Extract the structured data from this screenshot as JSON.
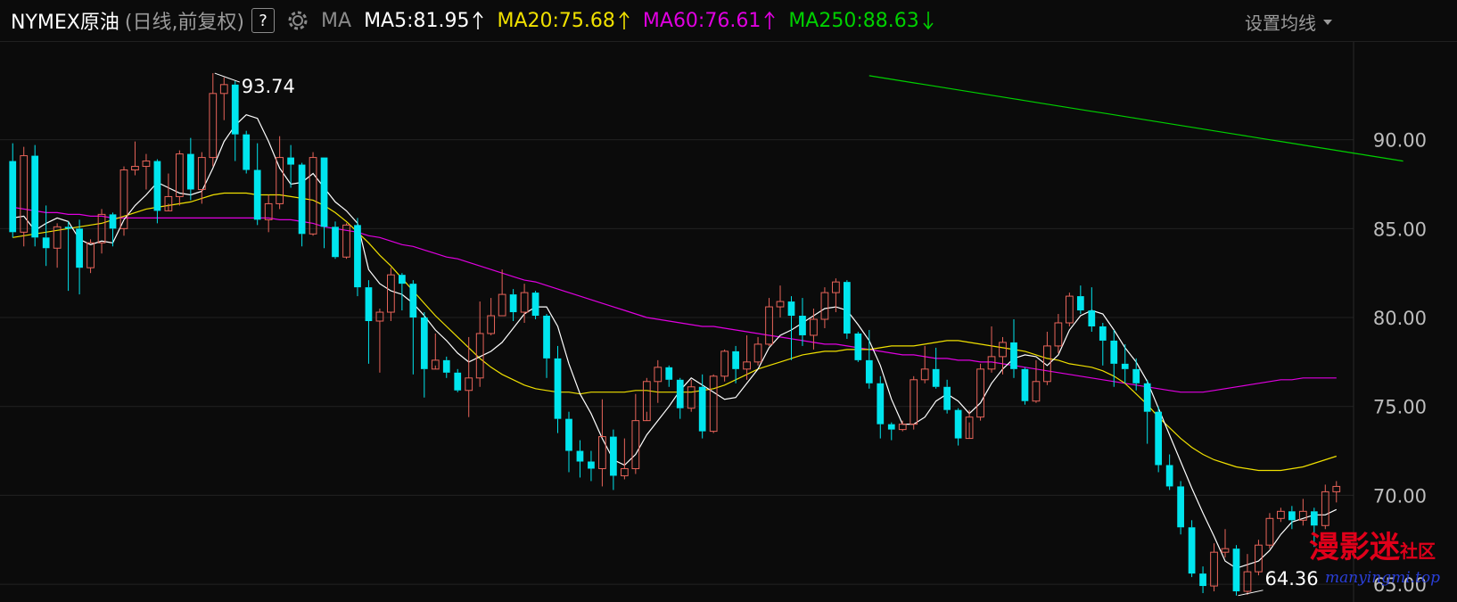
{
  "header": {
    "title": "NYMEX原油",
    "subtitle": "(日线,前复权)",
    "help": "?",
    "ma_label": "MA",
    "ma": [
      {
        "text": "MA5:81.95",
        "color": "#ffffff",
        "dir": "up"
      },
      {
        "text": "MA20:75.68",
        "color": "#f0e000",
        "dir": "up"
      },
      {
        "text": "MA60:76.61",
        "color": "#e000e0",
        "dir": "up"
      },
      {
        "text": "MA250:88.63",
        "color": "#00d000",
        "dir": "down"
      }
    ],
    "settings": "设置均线"
  },
  "watermark": {
    "main": "漫影迷",
    "small": "社区",
    "url": "manyingmi.top"
  },
  "colors": {
    "up": "#e8645a",
    "down": "#00e5ee",
    "ma5": "#ffffff",
    "ma20": "#f0e000",
    "ma60": "#e000e0",
    "ma250": "#00d000"
  },
  "chart_data": {
    "type": "candlestick",
    "y_axis": {
      "ticks": [
        "90.00",
        "85.00",
        "80.00",
        "75.00",
        "70.00",
        "65.00"
      ],
      "range": [
        64,
        95.5
      ]
    },
    "annotations": [
      {
        "text": "93.74",
        "candle": 18,
        "value": 93.74
      },
      {
        "text": "64.36",
        "candle": 110,
        "value": 64.36
      }
    ],
    "candles": [
      [
        88.8,
        84.8,
        89.8,
        84.5
      ],
      [
        84.8,
        89.1,
        89.6,
        84.0
      ],
      [
        89.1,
        84.5,
        89.7,
        84.0
      ],
      [
        84.5,
        83.9,
        86.3,
        82.9
      ],
      [
        83.9,
        85.1,
        85.3,
        82.8
      ],
      [
        85.1,
        85.0,
        85.4,
        81.5
      ],
      [
        85.0,
        82.8,
        85.5,
        81.3
      ],
      [
        82.8,
        84.2,
        84.4,
        82.5
      ],
      [
        84.2,
        85.8,
        86.1,
        83.6
      ],
      [
        85.8,
        85.0,
        85.9,
        84.0
      ],
      [
        85.0,
        88.3,
        88.5,
        84.6
      ],
      [
        88.3,
        88.5,
        89.9,
        88.0
      ],
      [
        88.5,
        88.8,
        89.2,
        87.2
      ],
      [
        88.8,
        86.0,
        88.9,
        85.3
      ],
      [
        86.0,
        86.8,
        88.1,
        86.4
      ],
      [
        86.8,
        89.2,
        89.4,
        86.3
      ],
      [
        89.2,
        87.2,
        90.1,
        86.6
      ],
      [
        87.2,
        89.0,
        89.3,
        86.4
      ],
      [
        89.0,
        92.6,
        93.74,
        88.5
      ],
      [
        92.6,
        93.1,
        93.5,
        91.1
      ],
      [
        93.1,
        90.3,
        93.3,
        88.8
      ],
      [
        90.3,
        88.3,
        90.5,
        88.1
      ],
      [
        88.3,
        85.5,
        89.8,
        85.2
      ],
      [
        85.5,
        86.4,
        86.9,
        84.8
      ],
      [
        86.4,
        89.0,
        90.2,
        86.1
      ],
      [
        89.0,
        88.6,
        89.7,
        87.3
      ],
      [
        88.6,
        84.7,
        88.7,
        84.0
      ],
      [
        84.7,
        89.0,
        89.3,
        84.6
      ],
      [
        89.0,
        85.1,
        89.0,
        83.9
      ],
      [
        85.1,
        83.4,
        85.4,
        83.3
      ],
      [
        83.4,
        85.2,
        85.3,
        83.3
      ],
      [
        85.2,
        81.7,
        85.6,
        81.2
      ],
      [
        81.7,
        79.8,
        82.1,
        77.4
      ],
      [
        79.8,
        80.3,
        80.5,
        76.9
      ],
      [
        80.3,
        82.4,
        82.8,
        79.8
      ],
      [
        82.4,
        81.9,
        82.5,
        80.4
      ],
      [
        81.9,
        80.0,
        82.1,
        76.8
      ],
      [
        80.0,
        77.1,
        80.3,
        75.5
      ],
      [
        77.1,
        77.6,
        79.1,
        77.3
      ],
      [
        77.6,
        76.9,
        77.8,
        76.6
      ],
      [
        76.9,
        75.9,
        77.1,
        75.8
      ],
      [
        75.9,
        76.6,
        78.9,
        74.4
      ],
      [
        76.6,
        79.1,
        80.9,
        76.1
      ],
      [
        79.1,
        80.1,
        81.1,
        79.0
      ],
      [
        80.1,
        81.3,
        82.7,
        80.1
      ],
      [
        81.3,
        80.3,
        81.6,
        79.8
      ],
      [
        80.3,
        81.4,
        81.9,
        79.7
      ],
      [
        81.4,
        80.1,
        81.5,
        79.9
      ],
      [
        80.1,
        77.7,
        80.2,
        76.6
      ],
      [
        77.7,
        74.3,
        78.4,
        73.5
      ],
      [
        74.3,
        72.5,
        74.7,
        71.3
      ],
      [
        72.5,
        71.9,
        73.1,
        71.0
      ],
      [
        71.9,
        71.5,
        72.5,
        70.8
      ],
      [
        71.5,
        73.3,
        75.4,
        70.5
      ],
      [
        73.3,
        71.1,
        73.7,
        70.3
      ],
      [
        71.1,
        71.5,
        73.2,
        70.9
      ],
      [
        71.5,
        74.2,
        75.7,
        71.2
      ],
      [
        74.2,
        76.4,
        76.6,
        74.7
      ],
      [
        76.4,
        77.2,
        77.6,
        75.2
      ],
      [
        77.2,
        76.5,
        77.3,
        76.1
      ],
      [
        76.5,
        74.9,
        76.6,
        74.3
      ],
      [
        74.9,
        76.1,
        76.5,
        74.7
      ],
      [
        76.1,
        73.6,
        76.8,
        73.2
      ],
      [
        73.6,
        76.7,
        76.8,
        73.5
      ],
      [
        76.7,
        78.1,
        78.2,
        76.4
      ],
      [
        78.1,
        77.1,
        78.4,
        76.3
      ],
      [
        77.1,
        77.5,
        79.0,
        76.5
      ],
      [
        77.5,
        78.5,
        78.9,
        77.3
      ],
      [
        78.5,
        80.6,
        81.1,
        78.4
      ],
      [
        80.6,
        80.9,
        81.8,
        80.0
      ],
      [
        80.9,
        80.1,
        81.2,
        77.6
      ],
      [
        80.1,
        79.0,
        81.1,
        78.4
      ],
      [
        79.0,
        79.9,
        80.5,
        78.2
      ],
      [
        79.9,
        81.4,
        81.7,
        79.4
      ],
      [
        81.4,
        82.0,
        82.2,
        80.3
      ],
      [
        82.0,
        79.1,
        82.1,
        78.8
      ],
      [
        79.1,
        77.6,
        79.2,
        77.5
      ],
      [
        77.6,
        76.3,
        79.3,
        76.0
      ],
      [
        76.3,
        74.0,
        76.7,
        73.2
      ],
      [
        74.0,
        73.7,
        74.1,
        73.1
      ],
      [
        73.7,
        74.0,
        74.2,
        73.6
      ],
      [
        74.0,
        76.5,
        76.7,
        73.7
      ],
      [
        76.5,
        77.1,
        78.4,
        76.3
      ],
      [
        77.1,
        76.1,
        78.3,
        76.0
      ],
      [
        76.1,
        74.8,
        76.5,
        74.6
      ],
      [
        74.8,
        73.2,
        74.9,
        72.8
      ],
      [
        73.2,
        74.4,
        74.8,
        74.1
      ],
      [
        74.4,
        77.1,
        77.4,
        74.2
      ],
      [
        77.1,
        77.8,
        79.5,
        76.9
      ],
      [
        77.8,
        78.6,
        78.9,
        76.8
      ],
      [
        78.6,
        77.1,
        79.9,
        76.6
      ],
      [
        77.1,
        75.3,
        77.2,
        75.1
      ],
      [
        75.3,
        76.4,
        77.6,
        75.2
      ],
      [
        76.4,
        78.4,
        79.2,
        76.2
      ],
      [
        78.4,
        79.7,
        80.2,
        78.0
      ],
      [
        79.7,
        81.2,
        81.4,
        79.5
      ],
      [
        81.2,
        80.4,
        81.8,
        80.2
      ],
      [
        80.4,
        79.5,
        81.7,
        79.2
      ],
      [
        79.5,
        78.7,
        79.7,
        77.3
      ],
      [
        78.7,
        77.4,
        79.3,
        76.1
      ],
      [
        77.4,
        77.1,
        78.5,
        76.3
      ],
      [
        77.1,
        76.3,
        77.7,
        75.9
      ],
      [
        76.3,
        74.7,
        76.5,
        72.9
      ],
      [
        74.7,
        71.7,
        75.0,
        71.3
      ],
      [
        71.7,
        70.5,
        72.3,
        70.3
      ],
      [
        70.5,
        68.2,
        70.8,
        67.8
      ],
      [
        68.2,
        65.6,
        68.6,
        65.4
      ],
      [
        65.6,
        64.9,
        66.0,
        64.5
      ],
      [
        64.9,
        66.8,
        67.3,
        64.6
      ],
      [
        66.8,
        67.0,
        68.1,
        66.5
      ],
      [
        67.0,
        64.6,
        67.2,
        64.36
      ],
      [
        64.6,
        65.7,
        66.7,
        64.4
      ],
      [
        65.7,
        67.2,
        67.5,
        65.5
      ],
      [
        67.2,
        68.7,
        69.0,
        67.0
      ],
      [
        68.7,
        69.1,
        69.3,
        68.5
      ],
      [
        69.1,
        68.6,
        69.4,
        68.1
      ],
      [
        68.6,
        69.1,
        69.8,
        68.3
      ],
      [
        69.1,
        68.3,
        69.3,
        67.1
      ],
      [
        68.3,
        70.2,
        70.6,
        68.1
      ],
      [
        70.2,
        70.5,
        70.8,
        69.6
      ]
    ],
    "ma5": [
      85.6,
      85.7,
      84.9,
      85.3,
      85.6,
      85.4,
      84.4,
      84.1,
      84.3,
      84.2,
      85.5,
      86.3,
      86.9,
      87.6,
      87.3,
      87.0,
      86.9,
      87.1,
      88.4,
      89.9,
      90.8,
      91.4,
      91.2,
      89.9,
      88.4,
      87.5,
      87.6,
      88.1,
      87.3,
      86.5,
      86.0,
      85.3,
      82.7,
      81.9,
      81.5,
      81.3,
      80.8,
      80.1,
      79.3,
      78.7,
      78.0,
      77.5,
      77.8,
      78.1,
      78.6,
      79.4,
      80.2,
      80.6,
      80.6,
      79.5,
      77.4,
      75.7,
      74.6,
      73.2,
      72.0,
      71.7,
      72.3,
      73.4,
      74.2,
      75.0,
      75.9,
      76.6,
      76.2,
      75.8,
      75.4,
      75.5,
      76.3,
      77.1,
      78.3,
      79.0,
      79.3,
      79.7,
      80.1,
      80.5,
      80.6,
      80.4,
      79.6,
      78.7,
      77.3,
      75.4,
      74.0,
      74.0,
      74.4,
      75.3,
      75.7,
      75.3,
      74.6,
      75.2,
      76.3,
      77.1,
      77.7,
      77.9,
      77.8,
      77.3,
      77.9,
      79.3,
      80.1,
      80.4,
      80.2,
      79.3,
      78.3,
      77.5,
      76.4,
      74.9,
      73.4,
      71.9,
      70.4,
      69.0,
      67.7,
      66.3,
      65.9,
      66.1,
      66.3,
      66.9,
      67.8,
      68.5,
      68.7,
      68.9,
      68.9,
      69.2
    ],
    "ma20": [
      84.5,
      84.6,
      84.7,
      84.8,
      84.9,
      85.0,
      85.1,
      85.2,
      85.3,
      85.5,
      85.7,
      85.9,
      86.1,
      86.2,
      86.3,
      86.4,
      86.5,
      86.7,
      86.9,
      87.0,
      87.0,
      87.0,
      86.9,
      86.9,
      86.9,
      86.8,
      86.7,
      86.6,
      86.3,
      85.9,
      85.4,
      84.8,
      84.2,
      83.5,
      82.9,
      82.2,
      81.5,
      80.8,
      80.1,
      79.5,
      78.9,
      78.3,
      77.7,
      77.2,
      76.8,
      76.5,
      76.2,
      76.0,
      75.9,
      75.8,
      75.8,
      75.7,
      75.8,
      75.8,
      75.8,
      75.8,
      75.9,
      75.9,
      75.8,
      75.8,
      75.8,
      75.8,
      75.9,
      76.0,
      76.2,
      76.5,
      76.8,
      77.1,
      77.3,
      77.5,
      77.7,
      77.9,
      78.0,
      78.1,
      78.1,
      78.2,
      78.2,
      78.2,
      78.3,
      78.4,
      78.4,
      78.4,
      78.5,
      78.6,
      78.7,
      78.7,
      78.6,
      78.5,
      78.4,
      78.3,
      78.2,
      78.1,
      77.9,
      77.7,
      77.6,
      77.4,
      77.3,
      77.2,
      77.0,
      76.7,
      76.3,
      75.7,
      75.1,
      74.4,
      73.8,
      73.2,
      72.7,
      72.3,
      72.0,
      71.8,
      71.6,
      71.5,
      71.4,
      71.4,
      71.4,
      71.5,
      71.6,
      71.8,
      72.0,
      72.2
    ],
    "ma60": [
      86.2,
      86.1,
      86.0,
      85.9,
      85.9,
      85.8,
      85.8,
      85.7,
      85.7,
      85.6,
      85.6,
      85.6,
      85.6,
      85.6,
      85.6,
      85.6,
      85.6,
      85.6,
      85.6,
      85.6,
      85.6,
      85.6,
      85.6,
      85.6,
      85.5,
      85.5,
      85.4,
      85.3,
      85.1,
      85.0,
      84.9,
      84.8,
      84.6,
      84.5,
      84.3,
      84.1,
      84.0,
      83.8,
      83.6,
      83.4,
      83.3,
      83.1,
      82.9,
      82.7,
      82.5,
      82.3,
      82.1,
      82.0,
      81.8,
      81.6,
      81.4,
      81.2,
      81.0,
      80.8,
      80.6,
      80.4,
      80.2,
      80.0,
      79.9,
      79.8,
      79.7,
      79.6,
      79.5,
      79.5,
      79.4,
      79.3,
      79.2,
      79.1,
      79.0,
      78.9,
      78.8,
      78.7,
      78.6,
      78.5,
      78.5,
      78.4,
      78.3,
      78.2,
      78.1,
      78.0,
      77.9,
      77.9,
      77.8,
      77.7,
      77.7,
      77.6,
      77.6,
      77.5,
      77.5,
      77.4,
      77.3,
      77.2,
      77.1,
      77.0,
      76.9,
      76.8,
      76.7,
      76.6,
      76.5,
      76.4,
      76.3,
      76.2,
      76.1,
      76.0,
      75.9,
      75.8,
      75.8,
      75.8,
      75.9,
      76.0,
      76.1,
      76.2,
      76.3,
      76.4,
      76.5,
      76.5,
      76.6,
      76.6,
      76.6,
      76.6
    ],
    "ma250_start": 77,
    "ma250": [
      93.6,
      93.5,
      93.4,
      93.3,
      93.2,
      93.1,
      93.0,
      92.9,
      92.8,
      92.7,
      92.6,
      92.5,
      92.4,
      92.3,
      92.2,
      92.1,
      92.0,
      91.9,
      91.8,
      91.7,
      91.6,
      91.5,
      91.4,
      91.3,
      91.2,
      91.1,
      91.0,
      90.9,
      90.8,
      90.7,
      90.6,
      90.5,
      90.4,
      90.3,
      90.2,
      90.1,
      90.0,
      89.9,
      89.8,
      89.7,
      89.6,
      89.5,
      89.4,
      89.3,
      89.2,
      89.1,
      89.0,
      88.9,
      88.8
    ]
  }
}
